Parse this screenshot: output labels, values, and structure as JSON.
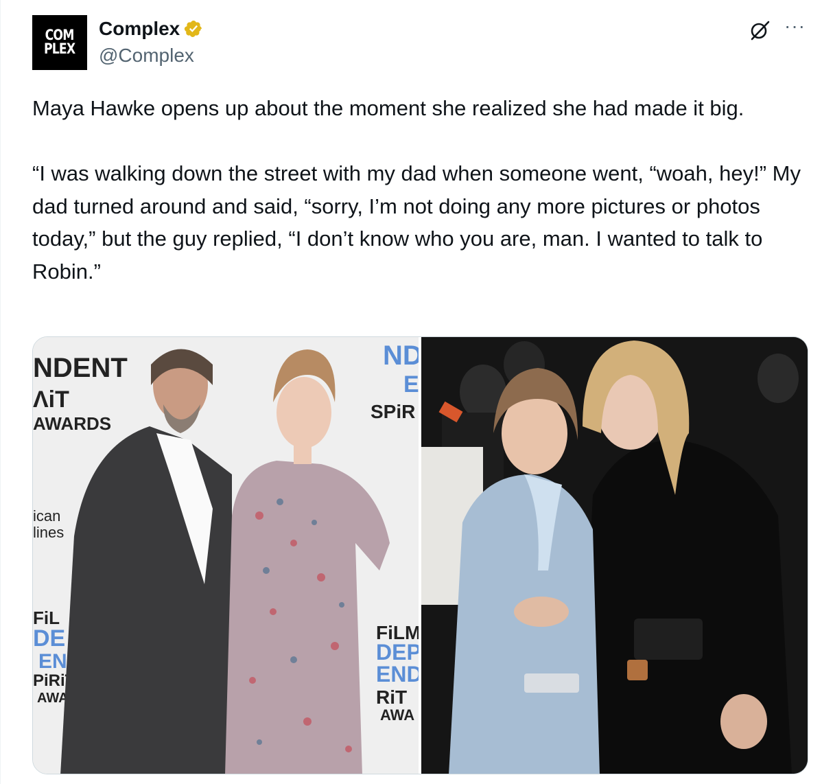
{
  "author": {
    "avatar_text": [
      "COM",
      "PLEX"
    ],
    "display_name": "Complex",
    "handle": "@Complex",
    "verified": true,
    "verified_color": "#e2b719"
  },
  "actions": {
    "grok_icon": "grok-icon",
    "more_icon": "more-icon",
    "more_label": "···"
  },
  "tweet": {
    "paragraphs": [
      "Maya Hawke opens up about the moment she realized she had made it big.",
      "“I was walking down the street with my dad when someone went, “woah, hey!” My dad turned around and said, “sorry, I’m not doing any more pictures or photos today,” but the guy replied, “I don’t know who you are, man. I wanted to talk to Robin.”"
    ]
  },
  "media": {
    "left_photo": {
      "backdrop_text": [
        "NDENT",
        "ΛiT",
        "AWARDS",
        "ican",
        "lines",
        "ND",
        "E",
        "SPiR",
        "FiL",
        "DE",
        "EN",
        "PiRiT",
        "AWAR",
        "FiLM",
        "DEP",
        "END",
        "RiT",
        "AWA"
      ]
    },
    "right_photo": {}
  },
  "colors": {
    "text_primary": "#0f1419",
    "text_secondary": "#536471",
    "border": "#cfd9de"
  }
}
